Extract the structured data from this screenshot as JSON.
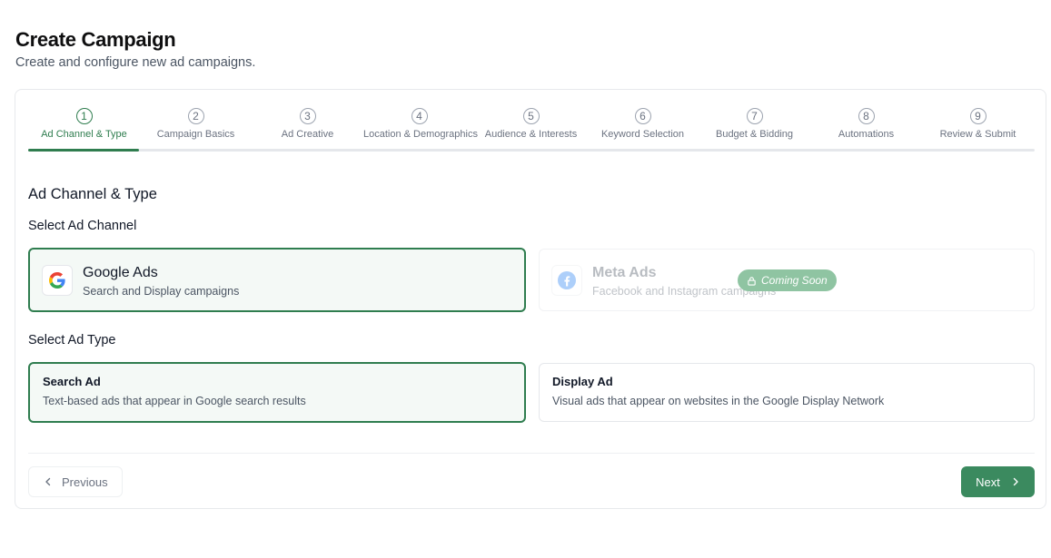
{
  "header": {
    "title": "Create Campaign",
    "subtitle": "Create and configure new ad campaigns."
  },
  "stepper": {
    "current_step": 1,
    "progress_fraction": 0.11,
    "steps": [
      {
        "number": "1",
        "label": "Ad Channel & Type"
      },
      {
        "number": "2",
        "label": "Campaign Basics"
      },
      {
        "number": "3",
        "label": "Ad Creative"
      },
      {
        "number": "4",
        "label": "Location & Demographics"
      },
      {
        "number": "5",
        "label": "Audience & Interests"
      },
      {
        "number": "6",
        "label": "Keyword Selection"
      },
      {
        "number": "7",
        "label": "Budget & Bidding"
      },
      {
        "number": "8",
        "label": "Automations"
      },
      {
        "number": "9",
        "label": "Review & Submit"
      }
    ]
  },
  "section_title": "Ad Channel & Type",
  "channel": {
    "heading": "Select Ad Channel",
    "options": [
      {
        "name": "Google Ads",
        "description": "Search and Display campaigns",
        "icon": "google-icon",
        "selected": true
      },
      {
        "name": "Meta Ads",
        "description": "Facebook and Instagram campaigns",
        "icon": "facebook-icon",
        "disabled": true,
        "badge": "Coming Soon",
        "badge_icon": "lock-icon"
      }
    ]
  },
  "ad_type": {
    "heading": "Select Ad Type",
    "options": [
      {
        "name": "Search Ad",
        "description": "Text-based ads that appear in Google search results",
        "selected": true
      },
      {
        "name": "Display Ad",
        "description": "Visual ads that appear on websites in the Google Display Network",
        "selected": false
      }
    ]
  },
  "footer": {
    "previous_label": "Previous",
    "next_label": "Next"
  },
  "colors": {
    "accent": "#2f7d4f",
    "button": "#3b8a5f",
    "badge": "#8fc4a2"
  }
}
